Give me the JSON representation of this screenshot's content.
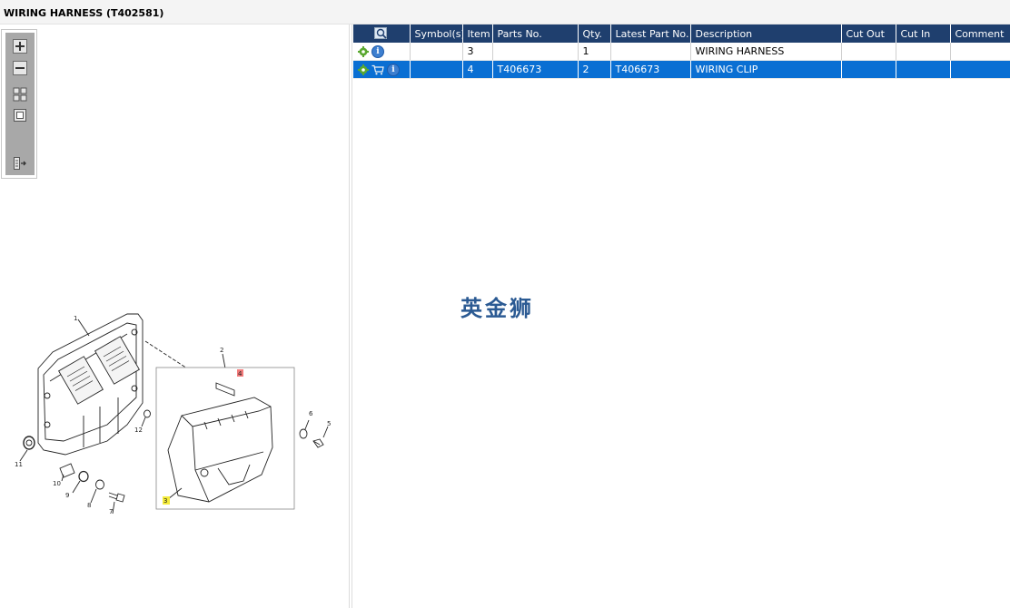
{
  "window": {
    "title": "WIRING HARNESS (T402581)"
  },
  "toolbox": {
    "tools": [
      {
        "name": "zoom-in",
        "icon": "plus-icon"
      },
      {
        "name": "zoom-out",
        "icon": "minus-icon"
      },
      {
        "name": "fit",
        "icon": "grid-icon"
      },
      {
        "name": "actual-size",
        "icon": "square-icon"
      },
      {
        "name": "toggle-panel",
        "icon": "panel-arrow-icon"
      }
    ]
  },
  "diagram": {
    "callouts": [
      "1",
      "2",
      "4",
      "6",
      "5",
      "12",
      "11",
      "10",
      "9",
      "8",
      "7",
      "3"
    ],
    "highlighted": {
      "red": "4",
      "yellow": "3"
    }
  },
  "watermark": "英金狮",
  "table": {
    "columns": [
      "",
      "Symbol(s)",
      "Item",
      "Parts No.",
      "Qty.",
      "Latest Part No.",
      "Description",
      "Cut Out",
      "Cut In",
      "Comment"
    ],
    "rows": [
      {
        "item": "3",
        "parts_no": "",
        "qty": "1",
        "latest": "",
        "description": "WIRING HARNESS",
        "cut_out": "",
        "cut_in": "",
        "comment": "",
        "selected": false,
        "cart": false
      },
      {
        "item": "4",
        "parts_no": "T406673",
        "qty": "2",
        "latest": "T406673",
        "description": "WIRING CLIP",
        "cut_out": "",
        "cut_in": "",
        "comment": "",
        "selected": true,
        "cart": true
      }
    ]
  },
  "colors": {
    "header": "#1f3f6e",
    "selected": "#0a6fd3",
    "watermark": "#2b5a93",
    "gear": "#5aa830"
  }
}
